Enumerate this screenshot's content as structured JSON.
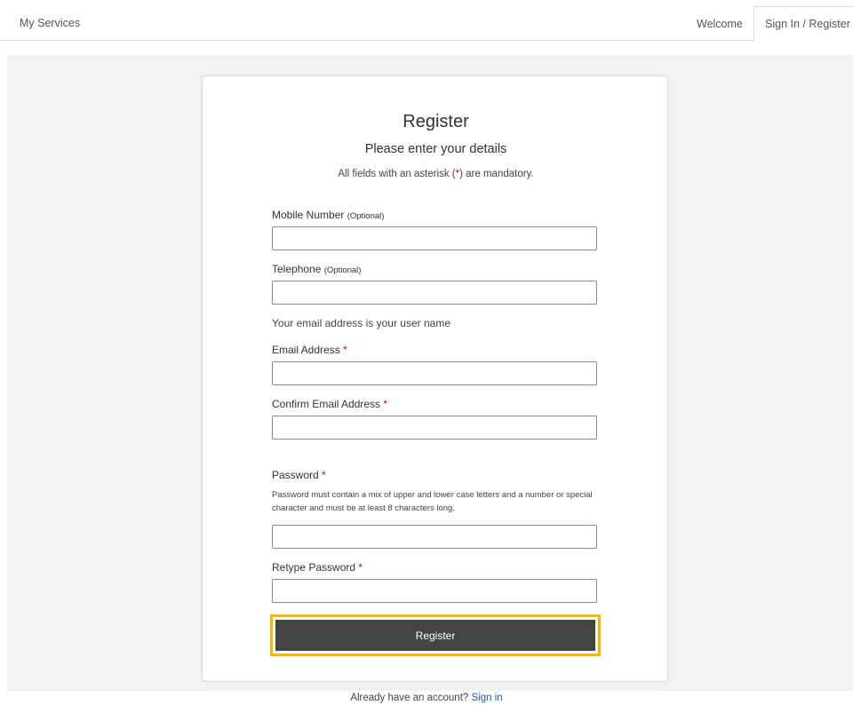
{
  "nav": {
    "brand": "My Services",
    "welcome": "Welcome",
    "signin_register": "Sign In / Register"
  },
  "form": {
    "title": "Register",
    "subtitle": "Please enter your details",
    "mandatory_prefix": "All fields with an asterisk (",
    "mandatory_asterisk": "*",
    "mandatory_suffix": ") are mandatory.",
    "asterisk": "*",
    "mobile": {
      "label": "Mobile Number",
      "optional": "(Optional)",
      "value": ""
    },
    "telephone": {
      "label": "Telephone",
      "optional": "(Optional)",
      "value": ""
    },
    "email_note": "Your email address is your user name",
    "email": {
      "label": "Email Address",
      "value": ""
    },
    "confirm_email": {
      "label": "Confirm Email Address",
      "value": ""
    },
    "password": {
      "label": "Password",
      "hint": "Password must contain a mix of upper and lower case letters and a number or special character and must be at least 8 characters long.",
      "value": ""
    },
    "retype_password": {
      "label": "Retype Password",
      "value": ""
    },
    "submit_label": "Register"
  },
  "footer": {
    "text": "Already have an account?",
    "link": "Sign in"
  },
  "colors": {
    "accent_focus": "#f6b800",
    "button_bg": "#444444",
    "link": "#1f5ca6",
    "required": "#d0021b"
  }
}
